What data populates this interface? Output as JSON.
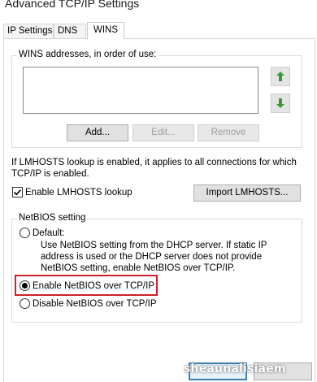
{
  "window": {
    "title": "Advanced TCP/IP Settings"
  },
  "tabs": [
    {
      "label": "IP Settings",
      "active": false
    },
    {
      "label": "DNS",
      "active": false
    },
    {
      "label": "WINS",
      "active": true
    }
  ],
  "wins": {
    "group_label": "WINS addresses, in order of use:",
    "addresses": [],
    "up_icon": "green-up-arrow-icon",
    "down_icon": "green-down-arrow-icon",
    "add_label": "Add...",
    "edit_label": "Edit...",
    "remove_label": "Remove"
  },
  "lmhosts": {
    "description": "If LMHOSTS lookup is enabled, it applies to all connections for which TCP/IP is enabled.",
    "checkbox_label": "Enable LMHOSTS lookup",
    "checked": true,
    "import_label": "Import LMHOSTS..."
  },
  "netbios": {
    "group_label": "NetBIOS setting",
    "options": [
      {
        "label": "Default:",
        "selected": false,
        "description": "Use NetBIOS setting from the DHCP server. If static IP address is used or the DHCP server does not provide NetBIOS setting, enable NetBIOS over TCP/IP."
      },
      {
        "label": "Enable NetBIOS over TCP/IP",
        "selected": true
      },
      {
        "label": "Disable NetBIOS over TCP/IP",
        "selected": false
      }
    ],
    "highlight_color": "#d21f26"
  },
  "watermark": {
    "text": "sheaunalisiaem"
  },
  "colors": {
    "arrow_green": "#3a9a3a",
    "ok_border": "#3c7fb1"
  }
}
